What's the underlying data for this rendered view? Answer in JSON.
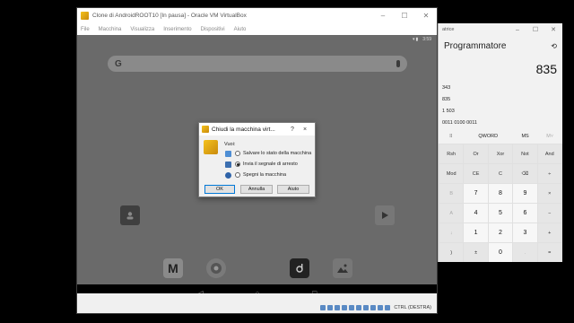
{
  "vbox": {
    "title": "Clone di AndroidROOT10 [In pausa] - Oracle VM VirtualBox",
    "menu": [
      "File",
      "Macchina",
      "Visualizza",
      "Inserimento",
      "Dispositivi",
      "Aiuto"
    ],
    "statusbar_host_key": "CTRL (DESTRA)"
  },
  "android": {
    "status_time": "3:59"
  },
  "dialog": {
    "title": "Chiudi la macchina virt...",
    "help": "?",
    "close": "×",
    "prompt": "Vuoi:",
    "options": [
      {
        "label": "Salvare lo stato della macchina",
        "checked": false
      },
      {
        "label": "Invia il segnale di arresto",
        "checked": true
      },
      {
        "label": "Spegni la macchina",
        "checked": false
      }
    ],
    "buttons": {
      "ok": "OK",
      "cancel": "Annulla",
      "help": "Aiuto"
    }
  },
  "calculator": {
    "title": "atrice",
    "mode": "Programmatore",
    "display": "835",
    "radix": {
      "hex": "343",
      "dec": "835",
      "oct": "1 503",
      "bin": "0011 0100 0011"
    },
    "tabs": [
      "QWORD",
      "MS",
      "M˅"
    ],
    "keys": [
      [
        "Rsh",
        "Or",
        "Xor",
        "Not",
        "And"
      ],
      [
        "Mod",
        "CE",
        "C",
        "⌫",
        "÷"
      ],
      [
        "B",
        "7",
        "8",
        "9",
        "×"
      ],
      [
        "A",
        "4",
        "5",
        "6",
        "−"
      ],
      [
        "↓",
        "1",
        "2",
        "3",
        "+"
      ],
      [
        ")",
        "±",
        "0",
        ".",
        "="
      ]
    ]
  },
  "taskbar": {}
}
